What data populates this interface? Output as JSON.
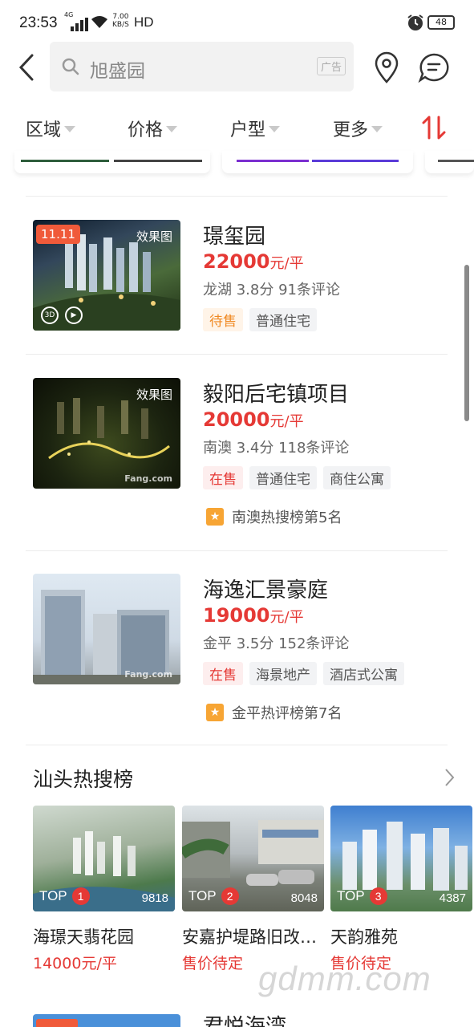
{
  "status_bar": {
    "time": "23:53",
    "network": "4G",
    "speed_top": "7.00",
    "speed_bottom": "KB/S",
    "hd": "HD",
    "battery": "48"
  },
  "search": {
    "text": "旭盛园",
    "ad_label": "广告"
  },
  "filters": [
    {
      "label": "区域"
    },
    {
      "label": "价格"
    },
    {
      "label": "户型"
    },
    {
      "label": "更多"
    }
  ],
  "listings": [
    {
      "title": "璟玺园",
      "price": "22000",
      "unit": "元/平",
      "meta": "龙湖  3.8分  91条评论",
      "image_label": "效果图",
      "promo_badge": "11.11",
      "tags": [
        {
          "text": "待售",
          "kind": "pre"
        },
        {
          "text": "普通住宅",
          "kind": "normal"
        }
      ],
      "rank": ""
    },
    {
      "title": "毅阳后宅镇项目",
      "price": "20000",
      "unit": "元/平",
      "meta": "南澳  3.4分  118条评论",
      "image_label": "效果图",
      "tags": [
        {
          "text": "在售",
          "kind": "sale"
        },
        {
          "text": "普通住宅",
          "kind": "normal"
        },
        {
          "text": "商住公寓",
          "kind": "normal"
        }
      ],
      "rank": "南澳热搜榜第5名"
    },
    {
      "title": "海逸汇景豪庭",
      "price": "19000",
      "unit": "元/平",
      "meta": "金平  3.5分  152条评论",
      "image_label": "",
      "tags": [
        {
          "text": "在售",
          "kind": "sale"
        },
        {
          "text": "海景地产",
          "kind": "normal"
        },
        {
          "text": "酒店式公寓",
          "kind": "normal"
        }
      ],
      "rank": "金平热评榜第7名"
    }
  ],
  "hot_search": {
    "title": "汕头热搜榜",
    "items": [
      {
        "top": "TOP",
        "rank": "1",
        "count": "9818",
        "name": "海璟天翡花园",
        "price": "14000元/平"
      },
      {
        "top": "TOP",
        "rank": "2",
        "count": "8048",
        "name": "安嘉护堤路旧改…",
        "price": "售价待定"
      },
      {
        "top": "TOP",
        "rank": "3",
        "count": "4387",
        "name": "天韵雅苑",
        "price": "售价待定"
      }
    ]
  },
  "next_listing_title": "君悦海湾",
  "watermark": "gdmm.com",
  "colors": {
    "accent_red": "#e53935",
    "pre_sale_orange": "#f08a24",
    "rank_star": "#f7a534"
  }
}
